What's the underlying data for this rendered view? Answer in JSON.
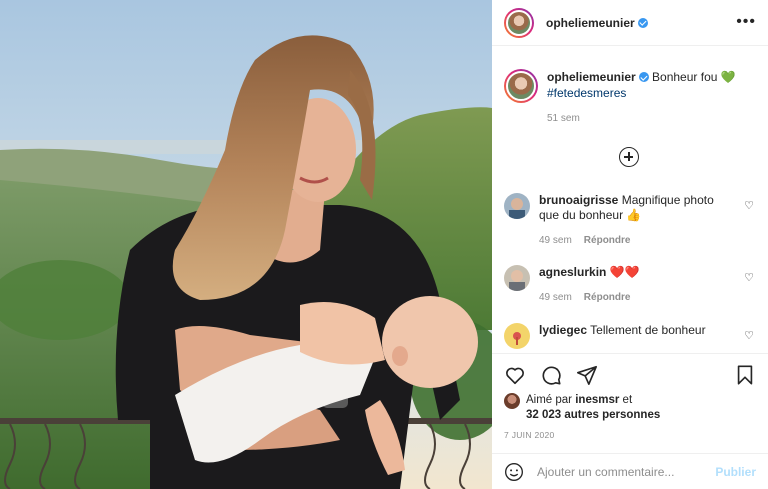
{
  "post": {
    "username": "opheliemeunier",
    "verified": true
  },
  "caption": {
    "username": "opheliemeunier",
    "text": "Bonheur fou",
    "emoji": "💚",
    "hashtag": "#fetedesmeres",
    "time": "51 sem"
  },
  "comments": [
    {
      "username": "brunoaigrisse",
      "text": "Magnifique photo que du bonheur",
      "emoji": "👍",
      "time": "49 sem",
      "reply": "Répondre"
    },
    {
      "username": "agneslurkin",
      "text": "",
      "emoji": "❤️❤️",
      "time": "49 sem",
      "reply": "Répondre"
    },
    {
      "username": "lydiegec",
      "text": "Tellement de bonheur",
      "emoji": "",
      "time": "",
      "reply": ""
    }
  ],
  "likes": {
    "prefix": "Aimé par",
    "by": "inesmsr",
    "and": "et",
    "others": "32 023 autres personnes"
  },
  "date": "7 JUIN 2020",
  "add_comment": {
    "placeholder": "Ajouter un commentaire...",
    "publish": "Publier"
  },
  "colors": {
    "link_blue": "#00376b",
    "publish_disabled": "#b2dffc",
    "verified_blue": "#3897f0",
    "secondary_text": "#8e8e8e"
  },
  "icons": [
    "more-options-icon",
    "add-circle-icon",
    "heart-icon",
    "comment-icon",
    "share-icon",
    "bookmark-icon",
    "emoji-icon"
  ]
}
